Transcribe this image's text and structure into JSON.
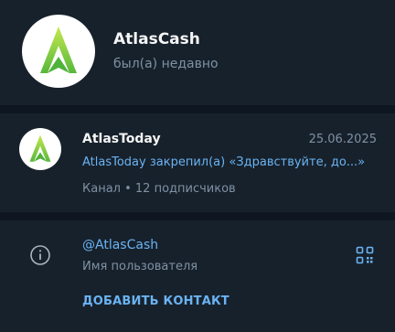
{
  "header": {
    "title": "AtlasCash",
    "status": "был(а) недавно"
  },
  "pinned_channel": {
    "name": "AtlasToday",
    "date": "25.06.2025",
    "message": "AtlasToday закрепил(а) «Здравствуйте, до...»",
    "meta": "Канал • 12 подписчиков"
  },
  "info": {
    "username": "@AtlasCash",
    "username_label": "Имя пользователя",
    "add_contact": "ДОБАВИТЬ КОНТАКТ"
  },
  "colors": {
    "background": "#0e1621",
    "panel": "#17212b",
    "accent": "#6ab3f3",
    "secondary_text": "#7f91a4",
    "logo_green_light": "#b8e04a",
    "logo_green_dark": "#4fb23b"
  },
  "icons": {
    "profile_logo": "atlas-logo",
    "info": "info-icon",
    "qr": "qr-code-icon"
  }
}
